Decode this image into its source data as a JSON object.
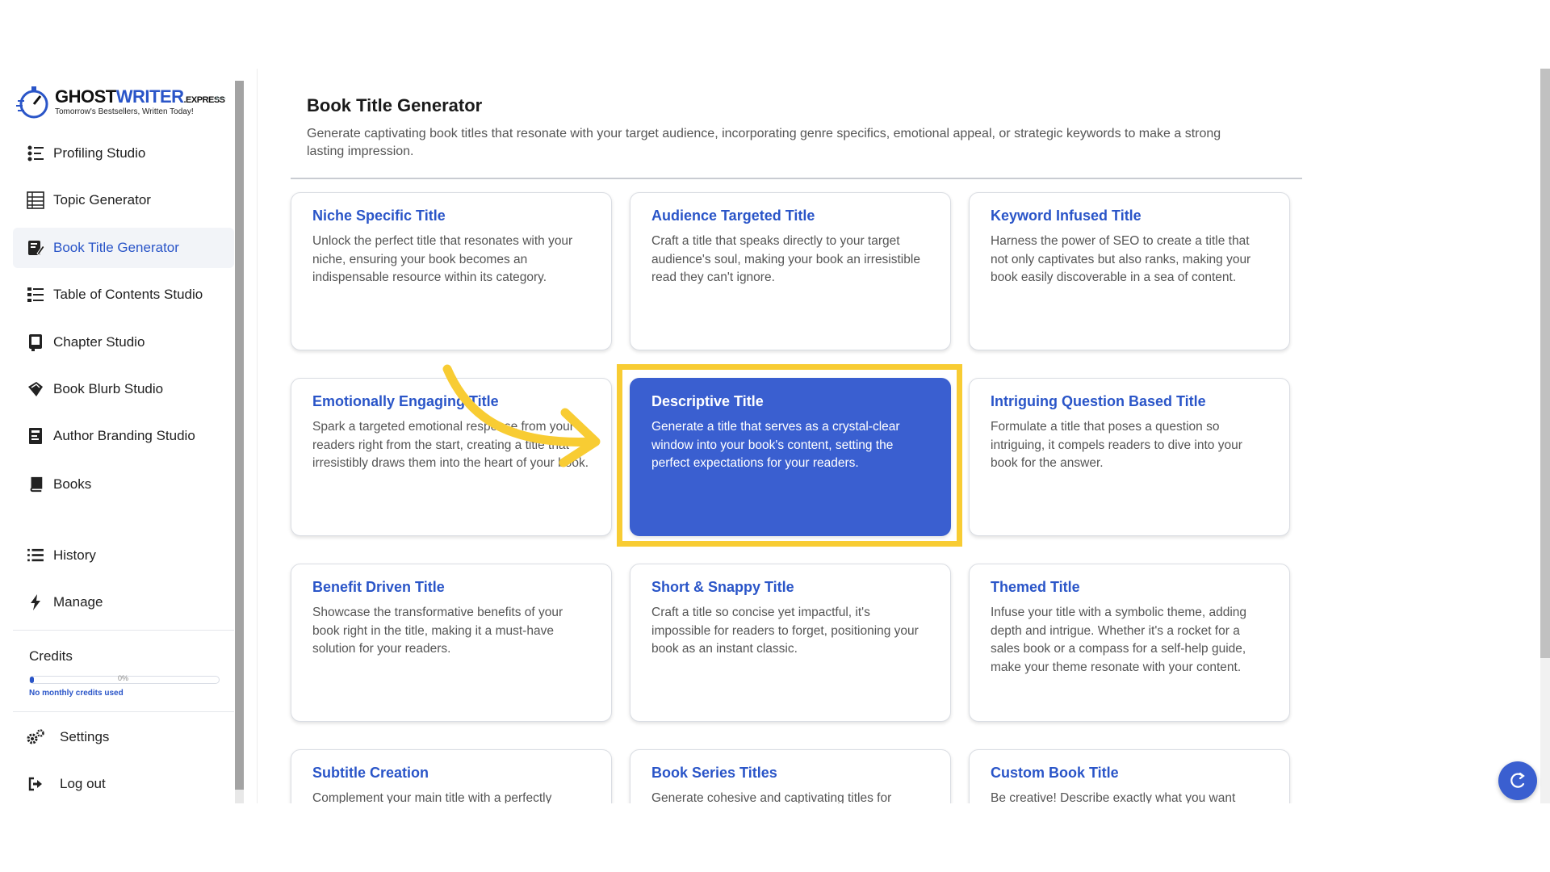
{
  "brand": {
    "logo_word_1": "GHOST",
    "logo_word_2": "WRITER",
    "logo_word_3": ".EXPRESS",
    "tagline": "Tomorrow's Bestsellers, Written Today!"
  },
  "sidebar": {
    "items": [
      {
        "label": "Profiling Studio",
        "icon": "profiling-icon"
      },
      {
        "label": "Topic Generator",
        "icon": "topic-list-icon"
      },
      {
        "label": "Book Title Generator",
        "icon": "title-edit-icon",
        "active": true
      },
      {
        "label": "Table of Contents Studio",
        "icon": "toc-list-icon"
      },
      {
        "label": "Chapter Studio",
        "icon": "chapter-book-icon"
      },
      {
        "label": "Book Blurb Studio",
        "icon": "blurb-icon"
      },
      {
        "label": "Author Branding Studio",
        "icon": "branding-icon"
      },
      {
        "label": "Books",
        "icon": "books-icon"
      },
      {
        "label": "History",
        "icon": "history-list-icon"
      },
      {
        "label": "Manage",
        "icon": "bolt-icon"
      }
    ],
    "credits": {
      "label": "Credits",
      "percent_text": "0%",
      "fill_fraction": 0.02,
      "note": "No monthly credits used"
    },
    "bottom": [
      {
        "label": "Settings",
        "icon": "gears-icon"
      },
      {
        "label": "Log out",
        "icon": "logout-icon"
      }
    ]
  },
  "main": {
    "title": "Book Title Generator",
    "description": "Generate captivating book titles that resonate with your target audience, incorporating genre specifics, emotional appeal, or strategic keywords to make a strong lasting impression.",
    "cards": [
      {
        "title": "Niche Specific Title",
        "desc": "Unlock the perfect title that resonates with your niche, ensuring your book becomes an indispensable resource within its category."
      },
      {
        "title": "Audience Targeted Title",
        "desc": "Craft a title that speaks directly to your target audience's soul, making your book an irresistible read they can't ignore."
      },
      {
        "title": "Keyword Infused Title",
        "desc": "Harness the power of SEO to create a title that not only captivates but also ranks, making your book easily discoverable in a sea of content."
      },
      {
        "title": "Emotionally Engaging Title",
        "desc": "Spark a targeted emotional response from your readers right from the start, creating a title that irresistibly draws them into the heart of your book."
      },
      {
        "title": "Descriptive Title",
        "desc": "Generate a title that serves as a crystal-clear window into your book's content, setting the perfect expectations for your readers.",
        "selected": true
      },
      {
        "title": "Intriguing Question Based Title",
        "desc": "Formulate a title that poses a question so intriguing, it compels readers to dive into your book for the answer."
      },
      {
        "title": "Benefit Driven Title",
        "desc": "Showcase the transformative benefits of your book right in the title, making it a must-have solution for your readers."
      },
      {
        "title": "Short & Snappy Title",
        "desc": "Craft a title so concise yet impactful, it's impossible for readers to forget, positioning your book as an instant classic."
      },
      {
        "title": "Themed Title",
        "desc": "Infuse your title with a symbolic theme, adding depth and intrigue. Whether it's a rocket for a sales book or a compass for a self-help guide, make your theme resonate with your content."
      },
      {
        "title": "Subtitle Creation",
        "desc": "Complement your main title with a perfectly"
      },
      {
        "title": "Book Series Titles",
        "desc": "Generate cohesive and captivating titles for"
      },
      {
        "title": "Custom Book Title",
        "desc": "Be creative! Describe exactly what you want"
      }
    ]
  },
  "colors": {
    "accent": "#2a55c8",
    "selected_card": "#3a5fd0",
    "highlight": "#f8cc33"
  }
}
